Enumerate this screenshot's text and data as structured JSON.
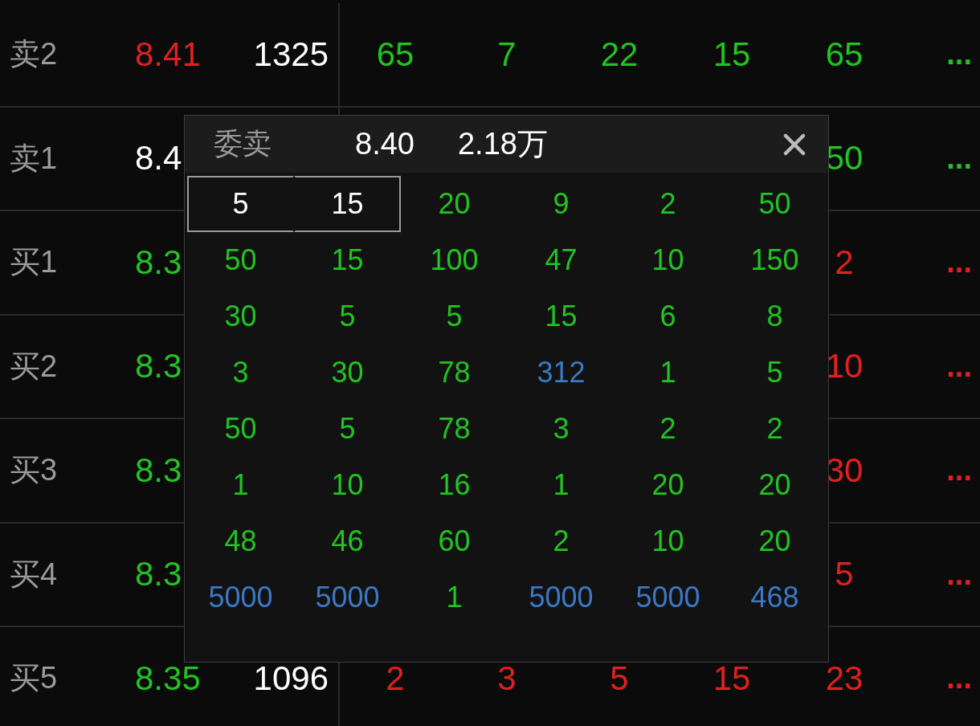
{
  "order_book": {
    "rows": [
      {
        "label": "卖2",
        "price": {
          "text": "8.41",
          "color": "#e02020"
        },
        "volume": "1325",
        "kind": "sell",
        "order_1": "65",
        "order_2": "7",
        "order_3": "22",
        "order_4": "15",
        "order_5": "65",
        "more": "..."
      },
      {
        "label": "卖1",
        "price": {
          "text": "8.4",
          "color": "#ffffff"
        },
        "kind": "sell",
        "order_5": "50",
        "more": "..."
      },
      {
        "label": "买1",
        "price": {
          "text": "8.3",
          "color": "#22c322"
        },
        "kind": "buy",
        "order_5": "2",
        "more": "..."
      },
      {
        "label": "买2",
        "price": {
          "text": "8.3",
          "color": "#22c322"
        },
        "kind": "buy",
        "order_5": "10",
        "more": "..."
      },
      {
        "label": "买3",
        "price": {
          "text": "8.3",
          "color": "#22c322"
        },
        "kind": "buy",
        "order_5": "30",
        "more": "..."
      },
      {
        "label": "买4",
        "price": {
          "text": "8.3",
          "color": "#22c322"
        },
        "kind": "buy",
        "order_5": "5",
        "more": "..."
      },
      {
        "label": "买5",
        "price": {
          "text": "8.35",
          "color": "#22c322"
        },
        "volume": "1096",
        "kind": "buy",
        "order_1": "2",
        "order_2": "3",
        "order_3": "5",
        "order_4": "15",
        "order_5": "23",
        "more": "..."
      }
    ]
  },
  "popup": {
    "title": "委卖",
    "price": "8.40",
    "volume": "2.18万",
    "grid": [
      [
        {
          "text": "5",
          "kind": "normal",
          "selected": true
        },
        {
          "text": "15",
          "kind": "normal",
          "selected": true
        },
        {
          "text": "20",
          "kind": "normal",
          "selected": false
        },
        {
          "text": "9",
          "kind": "normal",
          "selected": false
        },
        {
          "text": "2",
          "kind": "normal",
          "selected": false
        },
        {
          "text": "50",
          "kind": "normal",
          "selected": false
        }
      ],
      [
        {
          "text": "50",
          "kind": "normal",
          "selected": false
        },
        {
          "text": "15",
          "kind": "normal",
          "selected": false
        },
        {
          "text": "100",
          "kind": "normal",
          "selected": false
        },
        {
          "text": "47",
          "kind": "normal",
          "selected": false
        },
        {
          "text": "10",
          "kind": "normal",
          "selected": false
        },
        {
          "text": "150",
          "kind": "normal",
          "selected": false
        }
      ],
      [
        {
          "text": "30",
          "kind": "normal",
          "selected": false
        },
        {
          "text": "5",
          "kind": "normal",
          "selected": false
        },
        {
          "text": "5",
          "kind": "normal",
          "selected": false
        },
        {
          "text": "15",
          "kind": "normal",
          "selected": false
        },
        {
          "text": "6",
          "kind": "normal",
          "selected": false
        },
        {
          "text": "8",
          "kind": "normal",
          "selected": false
        }
      ],
      [
        {
          "text": "3",
          "kind": "normal",
          "selected": false
        },
        {
          "text": "30",
          "kind": "normal",
          "selected": false
        },
        {
          "text": "78",
          "kind": "normal",
          "selected": false
        },
        {
          "text": "312",
          "kind": "large",
          "selected": false
        },
        {
          "text": "1",
          "kind": "normal",
          "selected": false
        },
        {
          "text": "5",
          "kind": "normal",
          "selected": false
        }
      ],
      [
        {
          "text": "50",
          "kind": "normal",
          "selected": false
        },
        {
          "text": "5",
          "kind": "normal",
          "selected": false
        },
        {
          "text": "78",
          "kind": "normal",
          "selected": false
        },
        {
          "text": "3",
          "kind": "normal",
          "selected": false
        },
        {
          "text": "2",
          "kind": "normal",
          "selected": false
        },
        {
          "text": "2",
          "kind": "normal",
          "selected": false
        }
      ],
      [
        {
          "text": "1",
          "kind": "normal",
          "selected": false
        },
        {
          "text": "10",
          "kind": "normal",
          "selected": false
        },
        {
          "text": "16",
          "kind": "normal",
          "selected": false
        },
        {
          "text": "1",
          "kind": "normal",
          "selected": false
        },
        {
          "text": "20",
          "kind": "normal",
          "selected": false
        },
        {
          "text": "20",
          "kind": "normal",
          "selected": false
        }
      ],
      [
        {
          "text": "48",
          "kind": "normal",
          "selected": false
        },
        {
          "text": "46",
          "kind": "normal",
          "selected": false
        },
        {
          "text": "60",
          "kind": "normal",
          "selected": false
        },
        {
          "text": "2",
          "kind": "normal",
          "selected": false
        },
        {
          "text": "10",
          "kind": "normal",
          "selected": false
        },
        {
          "text": "20",
          "kind": "normal",
          "selected": false
        }
      ],
      [
        {
          "text": "5000",
          "kind": "large",
          "selected": false
        },
        {
          "text": "5000",
          "kind": "large",
          "selected": false
        },
        {
          "text": "1",
          "kind": "normal",
          "selected": false
        },
        {
          "text": "5000",
          "kind": "large",
          "selected": false
        },
        {
          "text": "5000",
          "kind": "large",
          "selected": false
        },
        {
          "text": "468",
          "kind": "large",
          "selected": false
        }
      ]
    ]
  }
}
